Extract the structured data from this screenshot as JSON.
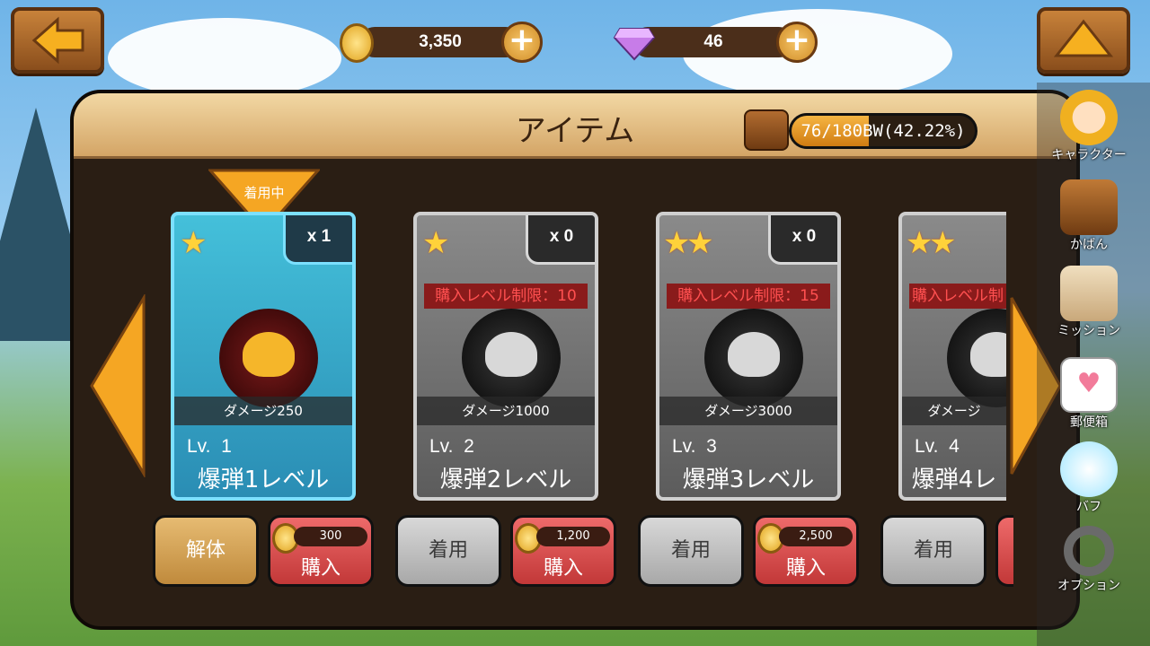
{
  "currency": {
    "coins": "3,350",
    "gems": "46"
  },
  "panel": {
    "title": "アイテム",
    "capacity_text": "76/180BW(42.22%)",
    "capacity_fraction": 0.4222
  },
  "equipped_tag": "着用中",
  "items": [
    {
      "stars": 1,
      "qty": "x 1",
      "restriction": "",
      "damage": "ダメージ250",
      "lv_label": "Lv.",
      "lv": "1",
      "name": "爆弾1レベル",
      "action": "解体",
      "price": "300",
      "buy": "購入",
      "equipped": true
    },
    {
      "stars": 1,
      "qty": "x 0",
      "restriction": "購入レベル制限：10",
      "damage": "ダメージ1000",
      "lv_label": "Lv.",
      "lv": "2",
      "name": "爆弾2レベル",
      "action": "着用",
      "price": "1,200",
      "buy": "購入",
      "equipped": false
    },
    {
      "stars": 2,
      "qty": "x 0",
      "restriction": "購入レベル制限：15",
      "damage": "ダメージ3000",
      "lv_label": "Lv.",
      "lv": "3",
      "name": "爆弾3レベル",
      "action": "着用",
      "price": "2,500",
      "buy": "購入",
      "equipped": false
    },
    {
      "stars": 2,
      "qty": "",
      "restriction": "購入レベル制",
      "damage": "ダメージ",
      "lv_label": "Lv.",
      "lv": "4",
      "name": "爆弾4レ",
      "action": "着用",
      "price": "",
      "buy": "",
      "equipped": false
    }
  ],
  "sidebar": [
    {
      "label": "キャラクター",
      "icon": "character-icon"
    },
    {
      "label": "かばん",
      "icon": "bag-icon"
    },
    {
      "label": "ミッション",
      "icon": "scroll-icon"
    },
    {
      "label": "郵便箱",
      "icon": "mail-icon"
    },
    {
      "label": "バフ",
      "icon": "wings-icon"
    },
    {
      "label": "オプション",
      "icon": "gear-icon"
    }
  ],
  "colors": {
    "accent": "#f5a623",
    "buy": "#d44848",
    "panel": "#2a1e14"
  }
}
